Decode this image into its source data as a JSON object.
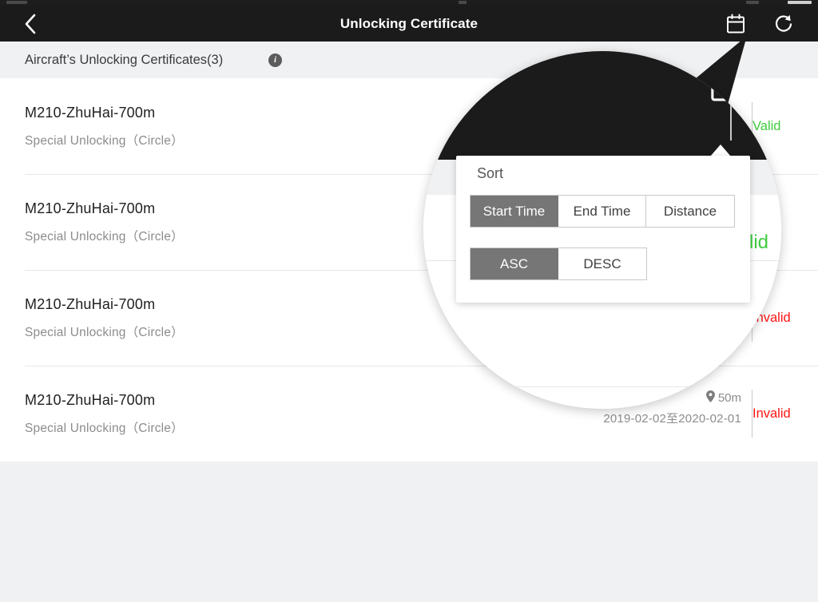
{
  "app": {
    "title": "Unlocking Certificate",
    "back_icon": "chevron-left-icon",
    "calendar_icon": "calendar-icon",
    "refresh_icon": "refresh-icon"
  },
  "subheader": {
    "text": "Aircraft’s Unlocking Certificates(3)",
    "info_icon": "info-icon",
    "info_glyph": "i"
  },
  "colors": {
    "appbar_bg": "#1b1b1b",
    "page_bg": "#f0f1f3",
    "valid": "#3ecc3e",
    "invalid": "#ff1515",
    "segment_selected": "#767676",
    "divider": "#e6e7e9"
  },
  "certificates": [
    {
      "name": "M210-ZhuHai-700m",
      "type": "Special Unlocking（Circle）",
      "distance": "",
      "date_range": "",
      "status": "Valid",
      "status_kind": "valid"
    },
    {
      "name": "M210-ZhuHai-700m",
      "type": "Special Unlocking（Circle）",
      "distance": "",
      "date_range": "",
      "status": "Valid",
      "status_kind": "valid"
    },
    {
      "name": "M210-ZhuHai-700m",
      "type": "Special Unlocking（Circle）",
      "distance": "",
      "date_range": "",
      "status": "Invalid",
      "status_kind": "invalid"
    },
    {
      "name": "M210-ZhuHai-700m",
      "type": "Special Unlocking（Circle）",
      "distance": "50m",
      "distance_icon": "location-pin-icon",
      "date_range": "2019-02-02至2020-02-01",
      "status": "Invalid",
      "status_kind": "invalid"
    }
  ],
  "magnifier": {
    "calendar_icon": "calendar-icon",
    "visible_status_1": "Valid",
    "visible_status_2": "lid",
    "visible_status_3": "nvalid"
  },
  "sort_popup": {
    "title": "Sort",
    "field_options": [
      {
        "label": "Start Time",
        "selected": true
      },
      {
        "label": "End Time",
        "selected": false
      },
      {
        "label": "Distance",
        "selected": false
      }
    ],
    "order_options": [
      {
        "label": "ASC",
        "selected": true
      },
      {
        "label": "DESC",
        "selected": false
      }
    ]
  }
}
